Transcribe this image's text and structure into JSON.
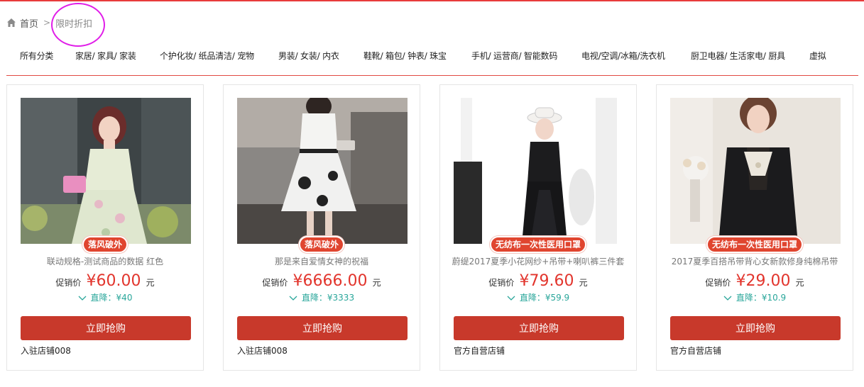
{
  "breadcrumb": {
    "home_label": "首页",
    "separator": ">",
    "current": "限时折扣"
  },
  "category_nav": [
    "所有分类",
    "家居/ 家具/ 家装",
    "个护化妆/ 纸品清洁/ 宠物",
    "男装/ 女装/ 内衣",
    "鞋靴/ 箱包/ 钟表/ 珠宝",
    "手机/ 运营商/ 智能数码",
    "电视/空调/冰箱/洗衣机",
    "厨卫电器/ 生活家电/ 厨具",
    "虚拟"
  ],
  "products": [
    {
      "badge": "落风破外",
      "title": "联动规格-测试商品的数据 红色",
      "price_label": "促销价",
      "currency": "¥",
      "price": "60.00",
      "unit": "元",
      "discount": "直降：¥40",
      "button": "立即抢购",
      "shop": "入驻店铺008"
    },
    {
      "badge": "落风破外",
      "title": "那是来自爱情女神的祝福",
      "price_label": "促销价",
      "currency": "¥",
      "price": "6666.00",
      "unit": "元",
      "discount": "直降：¥3333",
      "button": "立即抢购",
      "shop": "入驻店铺008"
    },
    {
      "badge": "无纺布一次性医用口罩",
      "title": "蔚缇2017夏季小花网纱+吊带+喇叭裤三件套",
      "price_label": "促销价",
      "currency": "¥",
      "price": "79.60",
      "unit": "元",
      "discount": "直降：¥59.9",
      "button": "立即抢购",
      "shop": "官方自营店铺"
    },
    {
      "badge": "无纺布一次性医用口罩",
      "title": "2017夏季百搭吊带背心女新款修身纯棉吊带",
      "price_label": "促销价",
      "currency": "¥",
      "price": "29.00",
      "unit": "元",
      "discount": "直降：¥10.9",
      "button": "立即抢购",
      "shop": "官方自营店铺"
    }
  ],
  "colors": {
    "accent": "#e2352d",
    "button": "#c8392b",
    "discount": "#29a69a",
    "highlight": "#e01ee8"
  }
}
